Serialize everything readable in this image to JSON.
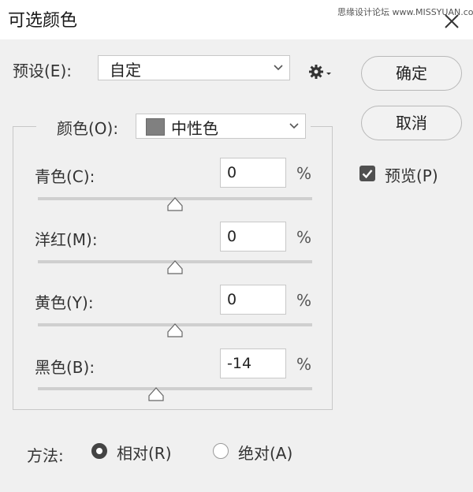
{
  "window": {
    "title": "可选颜色",
    "watermark": "思缘设计论坛 www.MISSYUAN.com"
  },
  "preset": {
    "label": "预设(E):",
    "value": "自定"
  },
  "buttons": {
    "ok": "确定",
    "cancel": "取消"
  },
  "preview": {
    "label": "预览(P)",
    "checked": true
  },
  "colors": {
    "label": "颜色(O):",
    "value": "中性色",
    "swatch": "#808080"
  },
  "sliders": [
    {
      "label": "青色(C):",
      "value": "0",
      "unit": "%",
      "position": 0.5
    },
    {
      "label": "洋红(M):",
      "value": "0",
      "unit": "%",
      "position": 0.5
    },
    {
      "label": "黄色(Y):",
      "value": "0",
      "unit": "%",
      "position": 0.5
    },
    {
      "label": "黑色(B):",
      "value": "-14",
      "unit": "%",
      "position": 0.43
    }
  ],
  "method": {
    "label": "方法:",
    "options": [
      {
        "label": "相对(R)",
        "selected": true
      },
      {
        "label": "绝对(A)",
        "selected": false
      }
    ]
  },
  "icons": {
    "close": "close-icon",
    "gear": "gear-icon",
    "check": "checkmark-icon"
  }
}
